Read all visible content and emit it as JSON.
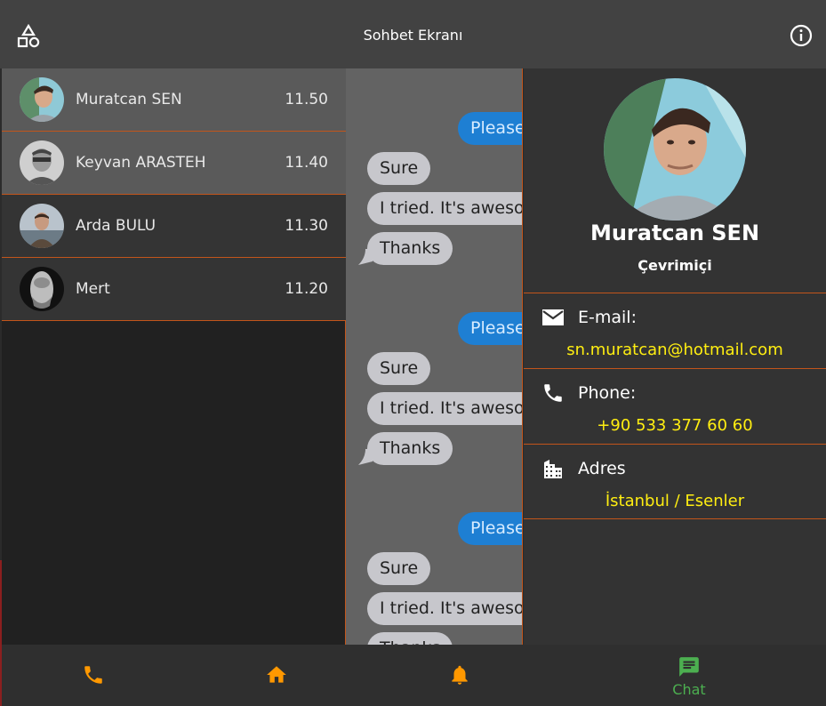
{
  "appbar": {
    "title": "Sohbet Ekranı"
  },
  "contacts": [
    {
      "name": "Muratcan SEN",
      "time": "11.50"
    },
    {
      "name": "Keyvan ARASTEH",
      "time": "11.40"
    },
    {
      "name": "Arda BULU",
      "time": "11.30"
    },
    {
      "name": "Mert",
      "time": "11.20"
    }
  ],
  "chat": {
    "groups": [
      {
        "out": "Please",
        "in1": "Sure",
        "in2": "I tried. It's awesome",
        "in3": "Thanks"
      },
      {
        "out": "Please",
        "in1": "Sure",
        "in2": "I tried. It's awesome",
        "in3": "Thanks"
      },
      {
        "out": "Please",
        "in1": "Sure",
        "in2": "I tried. It's awesome",
        "in3": "Thanks"
      }
    ]
  },
  "profile": {
    "name": "Muratcan SEN",
    "status": "Çevrimiçi",
    "email_label": "E-mail:",
    "email": "sn.muratcan@hotmail.com",
    "phone_label": "Phone:",
    "phone": "+90 533 377 60 60",
    "address_label": "Adres",
    "address": "İstanbul / Esenler"
  },
  "nav": {
    "chat_label": "Chat"
  },
  "colors": {
    "accent": "#ff9800",
    "divider": "#c2551b",
    "active": "#4caf50",
    "value": "#ffee11",
    "bubble_out": "#1e7fd3",
    "bubble_in": "#c7c7cc"
  }
}
